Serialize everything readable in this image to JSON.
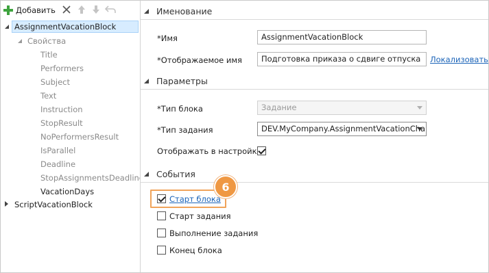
{
  "toolbar": {
    "add_label": "Добавить"
  },
  "tree": {
    "root_selected": "AssignmentVacationBlock",
    "properties_label": "Свойства",
    "properties": [
      "Title",
      "Performers",
      "Subject",
      "Text",
      "Instruction",
      "StopResult",
      "NoPerformersResult",
      "IsParallel",
      "Deadline",
      "StopAssignmentsDeadline",
      "VacationDays"
    ],
    "root_other": "ScriptVacationBlock"
  },
  "sections": {
    "naming": "Именование",
    "params": "Параметры",
    "events": "События"
  },
  "naming": {
    "name_label": "*Имя",
    "name_value": "AssignmentVacationBlock",
    "display_label": "*Отображаемое имя",
    "display_value": "Подготовка приказа о сдвиге отпуска",
    "localize_link": "Локализовать"
  },
  "params": {
    "block_type_label": "*Тип блока",
    "block_type_value": "Задание",
    "task_type_label": "*Тип задания",
    "task_type_value": "DEV.MyCompany.AssignmentVacationCha",
    "show_in_settings_label": "Отображать в настройках",
    "show_in_settings_checked": true
  },
  "events": {
    "items": [
      {
        "label": "Старт блока",
        "checked": true
      },
      {
        "label": "Старт задания",
        "checked": false
      },
      {
        "label": "Выполнение задания",
        "checked": false
      },
      {
        "label": "Конец блока",
        "checked": false
      }
    ]
  },
  "callout": {
    "number": "6",
    "color": "#ef9843"
  }
}
